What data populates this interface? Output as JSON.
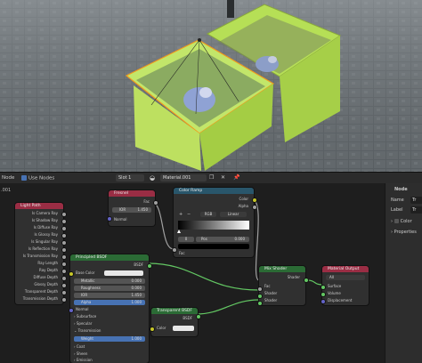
{
  "viewport": {
    "colors": {
      "cube": "#b9e25a",
      "floor": "#5d6266"
    }
  },
  "header": {
    "editor_label": "Node",
    "use_nodes_label": "Use Nodes",
    "slot_label": "Slot 1",
    "material_name": "Material.001"
  },
  "editor": {
    "breadcrumb": ".001"
  },
  "nodes": {
    "light_path": {
      "title": "Light Path",
      "outputs": [
        "Is Camera Ray",
        "Is Shadow Ray",
        "Is Diffuse Ray",
        "Is Glossy Ray",
        "Is Singular Ray",
        "Is Reflection Ray",
        "Is Transmission Ray",
        "Ray Length",
        "Ray Depth",
        "Diffuse Depth",
        "Glossy Depth",
        "Transparent Depth",
        "Transmission Depth"
      ]
    },
    "fresnel": {
      "title": "Fresnel",
      "out": "Fac",
      "ior_label": "IOR",
      "ior_value": "1.450",
      "normal_label": "Normal"
    },
    "color_ramp": {
      "title": "Color Ramp",
      "out_color": "Color",
      "out_alpha": "Alpha",
      "plus": "+",
      "minus": "−",
      "color_mode": "RGB",
      "interp": "Linear",
      "stop_index": "0",
      "pos_label": "Pos",
      "pos_value": "0.000",
      "fac_label": "Fac"
    },
    "principled": {
      "title": "Principled BSDF",
      "out": "BSDF",
      "base_color": "Base Color",
      "metallic_label": "Metallic",
      "metallic_value": "0.000",
      "roughness_label": "Roughness",
      "roughness_value": "0.000",
      "ior_label": "IOR",
      "ior_value": "1.450",
      "alpha_label": "Alpha",
      "alpha_value": "1.000",
      "normal": "Normal",
      "subsurface": "Subsurface",
      "specular": "Specular",
      "transmission": "Transmission",
      "weight_label": "Weight",
      "weight_value": "1.000",
      "coat": "Coat",
      "sheen": "Sheen",
      "emission": "Emission"
    },
    "transparent": {
      "title": "Transparent BSDF",
      "out": "BSDF",
      "color_label": "Color"
    },
    "mix_shader": {
      "title": "Mix Shader",
      "out": "Shader",
      "fac": "Fac",
      "in1": "Shader",
      "in2": "Shader"
    },
    "material_output": {
      "title": "Material Output",
      "target": "All",
      "surface": "Surface",
      "volume": "Volume",
      "displacement": "Displacement"
    }
  },
  "sidebar": {
    "tab": "Node",
    "name_label": "Name",
    "name_value": "Tr",
    "label_label": "Label",
    "label_value": "Tr",
    "color_section": "Color",
    "properties_section": "Properties"
  }
}
